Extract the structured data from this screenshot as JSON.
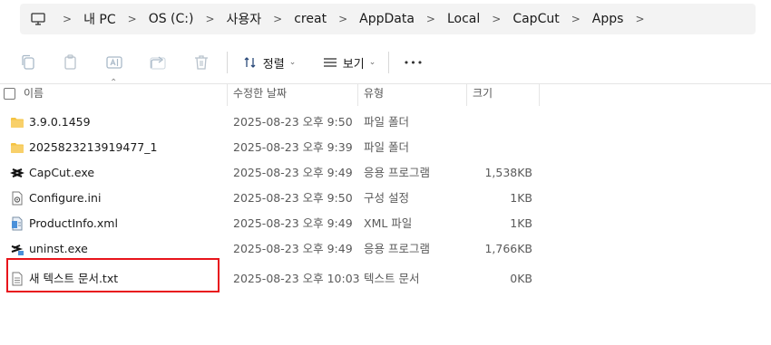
{
  "breadcrumb": {
    "items": [
      "내 PC",
      "OS (C:)",
      "사용자",
      "creat",
      "AppData",
      "Local",
      "CapCut",
      "Apps"
    ],
    "separator": ">"
  },
  "toolbar": {
    "sort_label": "정렬",
    "view_label": "보기",
    "more_label": "•••"
  },
  "columns": {
    "name": "이름",
    "date": "수정한 날짜",
    "type": "유형",
    "size": "크기"
  },
  "files": [
    {
      "name": "3.9.0.1459",
      "date": "2025-08-23 오후 9:50",
      "type": "파일 폴더",
      "size": "",
      "icon": "folder-icon"
    },
    {
      "name": "2025823213919477_1",
      "date": "2025-08-23 오후 9:39",
      "type": "파일 폴더",
      "size": "",
      "icon": "folder-icon"
    },
    {
      "name": "CapCut.exe",
      "date": "2025-08-23 오후 9:49",
      "type": "응용 프로그램",
      "size": "1,538KB",
      "icon": "capcut-app-icon"
    },
    {
      "name": "Configure.ini",
      "date": "2025-08-23 오후 9:50",
      "type": "구성 설정",
      "size": "1KB",
      "icon": "settings-file-icon"
    },
    {
      "name": "ProductInfo.xml",
      "date": "2025-08-23 오후 9:49",
      "type": "XML 파일",
      "size": "1KB",
      "icon": "xml-file-icon"
    },
    {
      "name": "uninst.exe",
      "date": "2025-08-23 오후 9:49",
      "type": "응용 프로그램",
      "size": "1,766KB",
      "icon": "uninstaller-icon"
    },
    {
      "name": "새 텍스트 문서.txt",
      "date": "2025-08-23 오후 10:03",
      "type": "텍스트 문서",
      "size": "0KB",
      "icon": "text-file-icon"
    }
  ],
  "colors": {
    "highlight": "#e8141b",
    "folder": "#f5c342",
    "addressbar_bg": "#f3f3f3"
  }
}
